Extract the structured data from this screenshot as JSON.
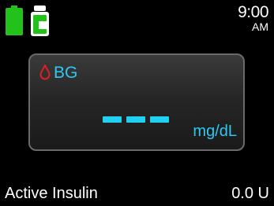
{
  "status_bar": {
    "battery_icon": "battery-full-icon",
    "reservoir_icon": "insulin-cartridge-icon",
    "time": "9:00",
    "ampm": "AM",
    "accent_color": "#22c21a"
  },
  "bg_card": {
    "label": "BG",
    "drop_icon": "blood-drop-icon",
    "drop_color": "#e02020",
    "value": "---",
    "unit": "mg/dL",
    "value_color": "#22d0f2"
  },
  "active_insulin": {
    "label": "Active Insulin",
    "value": "0.0 U"
  }
}
